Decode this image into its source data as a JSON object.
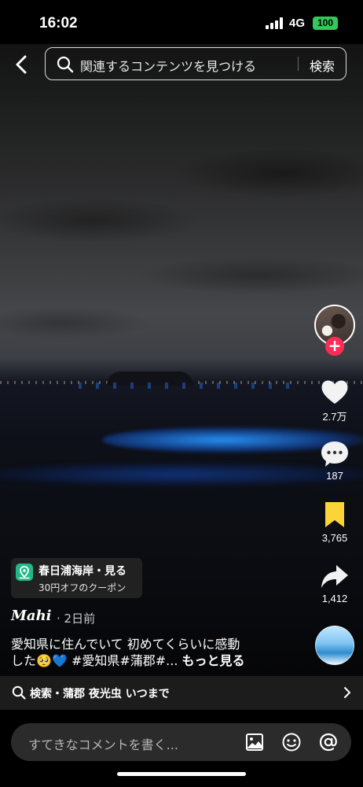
{
  "status_bar": {
    "time": "16:02",
    "network": "4G",
    "battery": "100"
  },
  "search": {
    "placeholder": "関連するコンテンツを見つける",
    "button_label": "検索"
  },
  "rail": {
    "likes": "2.7万",
    "comments": "187",
    "saves": "3,765",
    "shares": "1,412"
  },
  "location": {
    "title": "春日浦海岸・見る",
    "subtitle": "30円オフのクーポン"
  },
  "post": {
    "author": "Mahi",
    "date": "· 2日前",
    "caption_line1": "愛知県に住んでいて 初めてくらいに感動",
    "caption_line2_a": "した",
    "caption_emoji": "🥺💙",
    "caption_line2_b": " #愛知県#蒲郡#...",
    "more": "もっと見る"
  },
  "related_search": {
    "text": "検索・蒲郡 夜光虫 いつまで"
  },
  "comment_bar": {
    "placeholder": "すてきなコメントを書く..."
  },
  "colors": {
    "follow_red": "#fe2c55",
    "bookmark_yellow": "#fdd33a",
    "battery_green": "#34c759",
    "location_green": "#20b886"
  }
}
